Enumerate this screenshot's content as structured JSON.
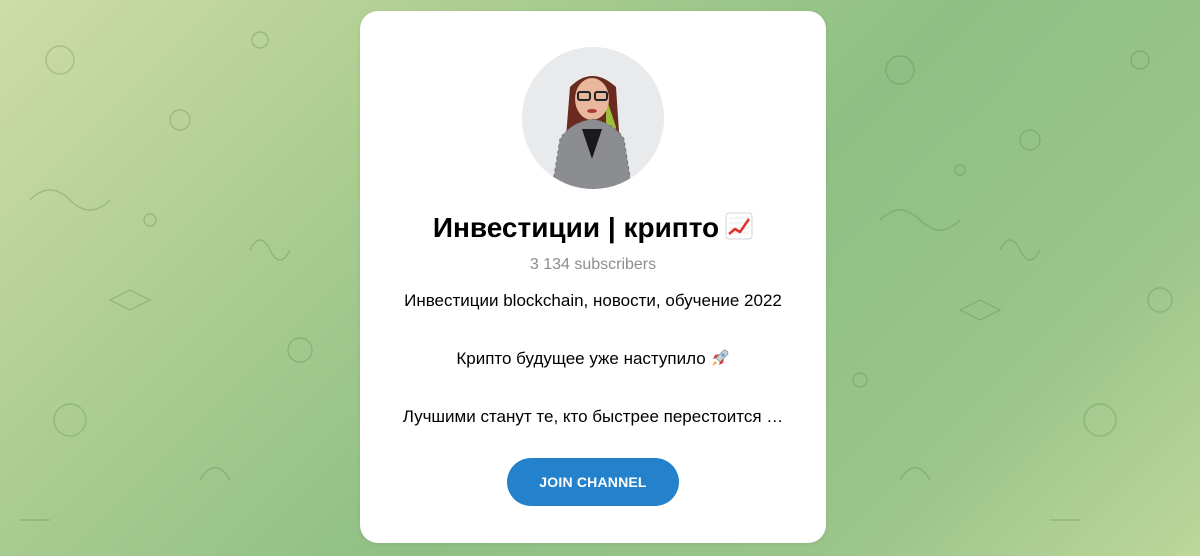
{
  "channel": {
    "title": "Инвестиции | крипто",
    "title_emoji": "chart-increasing-icon",
    "subscribers": "3 134 subscribers",
    "description": {
      "line1": "Инвестиции blockchain, новости, обучение 2022",
      "line2": "Крипто будущее уже наступило",
      "line2_emoji": "rocket-icon",
      "line3": "Лучшими станут те, кто быстрее перестоится …"
    },
    "join_label": "JOIN CHANNEL"
  },
  "colors": {
    "accent": "#2481cc",
    "muted_text": "#8a8f94",
    "card_bg": "#ffffff"
  }
}
